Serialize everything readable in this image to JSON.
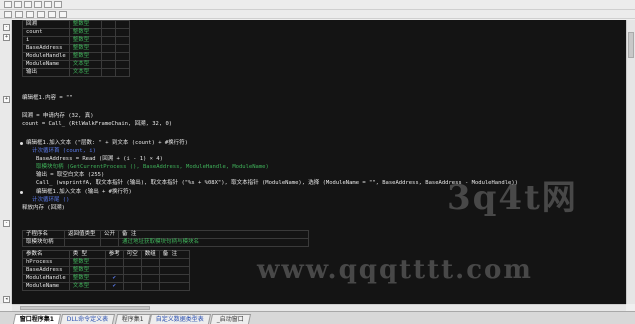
{
  "toolbar": {
    "buttons": 6
  },
  "locals": [
    {
      "name": "回溯",
      "type": "整数型"
    },
    {
      "name": "count",
      "type": "整数型"
    },
    {
      "name": "i",
      "type": "整数型"
    },
    {
      "name": "BaseAddress",
      "type": "整数型"
    },
    {
      "name": "ModuleHandle",
      "type": "整数型"
    },
    {
      "name": "ModuleName",
      "type": "文本型"
    },
    {
      "name": "输出",
      "type": "文本型"
    }
  ],
  "code": [
    {
      "text": "编辑框1.内容 = \"\"",
      "color": "white"
    },
    {
      "text": "回溯 = 申请内存 (32, 真)",
      "color": "white"
    },
    {
      "text": "count = Call_ (RtlWalkFrameChain, 回溯, 32, 0)",
      "color": "white"
    },
    {
      "text": "编辑框1.加入文本 (\"层数: \" + 到文本 (count) + #换行符)",
      "color": "white"
    },
    {
      "text": "计次循环首 (count, i)",
      "color": "blue"
    },
    {
      "text": "BaseAddress = Read (回溯 + (i - 1) × 4)",
      "color": "white"
    },
    {
      "text": "取模块句柄 (GetCurrentProcess (), BaseAddress, ModuleHandle, ModuleName)",
      "color": "green"
    },
    {
      "text": "输出 = 取空白文本 (255)",
      "color": "white"
    },
    {
      "text": "Call_ (wsprintfA, 取文本指针 (输出), 取文本指针 (\"%s + %08X\"), 取文本指针 (ModuleName), 选择 (ModuleName = \"\", BaseAddress, BaseAddress - ModuleHandle))",
      "color": "white"
    },
    {
      "text": "编辑框1.加入文本 (输出 + #换行符)",
      "color": "white"
    },
    {
      "text": "计次循环尾 ()",
      "color": "blue"
    },
    {
      "text": "释放内存 (回溯)",
      "color": "white"
    }
  ],
  "sub": {
    "headers": [
      "子程序名",
      "返回值类型",
      "公开",
      "备 注"
    ],
    "name_label": "取模块句柄",
    "note": "通过地址获取模块句柄与模块名",
    "param_headers": [
      "参数名",
      "类 型",
      "参考",
      "可空",
      "数组",
      "备 注"
    ],
    "params": [
      {
        "name": "hProcess",
        "type": "整数型",
        "ref": false
      },
      {
        "name": "BaseAddress",
        "type": "整数型",
        "ref": false
      },
      {
        "name": "ModuleHandle",
        "type": "整数型",
        "ref": true
      },
      {
        "name": "ModuleName",
        "type": "文本型",
        "ref": true
      }
    ]
  },
  "watermarks": {
    "logo": "3q4t网",
    "site": "www.qqqtttt.com"
  },
  "tabs": [
    {
      "label": "窗口程序集1",
      "active": true
    },
    {
      "label": "DLL命令定义表",
      "active": false
    },
    {
      "label": "程序集1",
      "active": false
    },
    {
      "label": "自定义数据类型表",
      "active": false
    },
    {
      "label": "_启动窗口",
      "active": false
    }
  ]
}
